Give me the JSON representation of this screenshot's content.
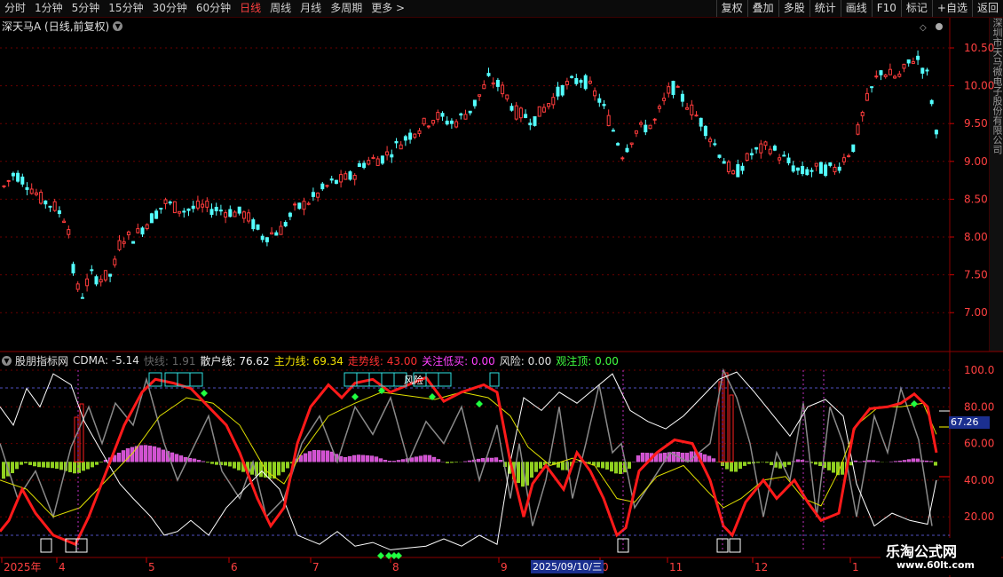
{
  "periods": [
    "分时",
    "1分钟",
    "5分钟",
    "15分钟",
    "30分钟",
    "60分钟",
    "日线",
    "周线",
    "月线",
    "多周期",
    "更多 >"
  ],
  "active_period": "日线",
  "right_buttons": [
    "复权",
    "叠加",
    "多股",
    "统计",
    "画线",
    "F10",
    "标记",
    "+自选",
    "返回"
  ],
  "stock_title": "深天马A (日线,前复权)",
  "price_axis": [
    "10.50",
    "10.00",
    "9.50",
    "9.00",
    "8.50",
    "8.00",
    "7.50",
    "7.00"
  ],
  "indicator_axis": [
    "100.0",
    "80.00",
    "60.00",
    "40.00",
    "20.00"
  ],
  "current_value": "67.26",
  "indicator": {
    "name": "股朋指标网",
    "cdma": "CDMA: -5.14",
    "fast": "快线: 1.91",
    "retail": "散户线: 76.62",
    "main": "主力线: 69.34",
    "trend": "走势线: 43.00",
    "low_buy": "关注低买: 0.00",
    "risk": "风险: 0.00",
    "top": "观注顶: 0.00"
  },
  "risk_label": "风险",
  "time_axis": [
    "2025年",
    "4",
    "5",
    "6",
    "7",
    "8",
    "9",
    "0",
    "11",
    "12",
    "1"
  ],
  "cursor_date": "2025/09/10/三",
  "right_tab_text": "深圳市天马微电子股份有限公司",
  "watermark": {
    "title": "乐淘公式网",
    "url": "www.60lt.com"
  },
  "colors": {
    "up": "#ff3c3c",
    "down": "#54ffff",
    "main_line": "#ff1a1a",
    "retail_line": "#ffffff",
    "trend_line": "#e0e000",
    "fast_line": "#8a8a8a",
    "pos_bar": "#d050d0",
    "neg_bar": "#90d020"
  }
}
